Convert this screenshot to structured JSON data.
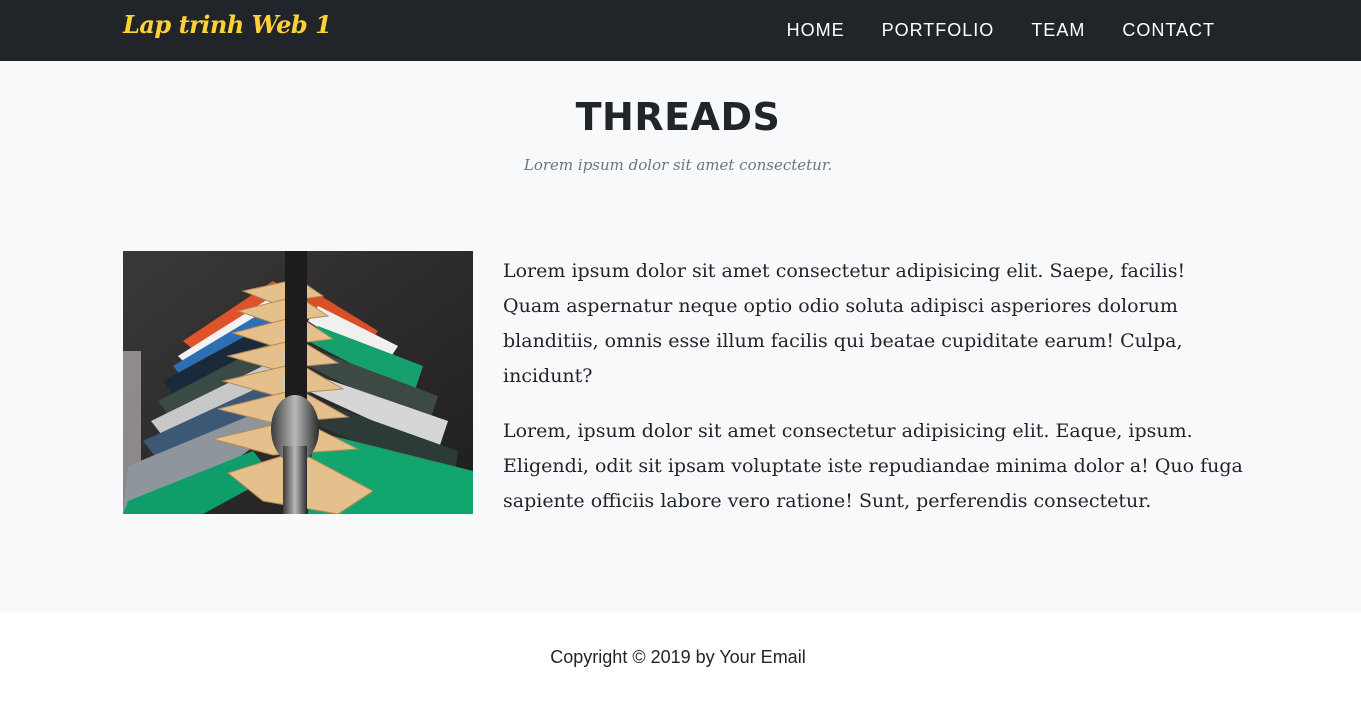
{
  "navbar": {
    "brand": "Lap trinh Web 1",
    "links": [
      "HOME",
      "PORTFOLIO",
      "TEAM",
      "CONTACT"
    ]
  },
  "section": {
    "title": "THREADS",
    "subtitle": "Lorem ipsum dolor sit amet consectetur.",
    "image_subject": "clothes-on-hangers",
    "paragraphs": [
      "Lorem ipsum dolor sit amet consectetur adipisicing elit. Saepe, facilis! Quam aspernatur neque optio odio soluta adipisci asperiores dolorum blanditiis, omnis esse illum facilis qui beatae cupiditate earum! Culpa, incidunt?",
      "Lorem, ipsum dolor sit amet consectetur adipisicing elit. Eaque, ipsum. Eligendi, odit sit ipsam voluptate iste repudiandae minima dolor a! Quo fuga sapiente officiis labore vero ratione! Sunt, perferendis consectetur."
    ]
  },
  "footer": {
    "copyright": "Copyright © 2019 by Your Email"
  },
  "colors": {
    "navbar_bg": "#212529",
    "brand": "#fed136",
    "section_bg": "#f8f9fa",
    "footer_bg": "#ffffff",
    "muted_text": "#6c757d"
  }
}
